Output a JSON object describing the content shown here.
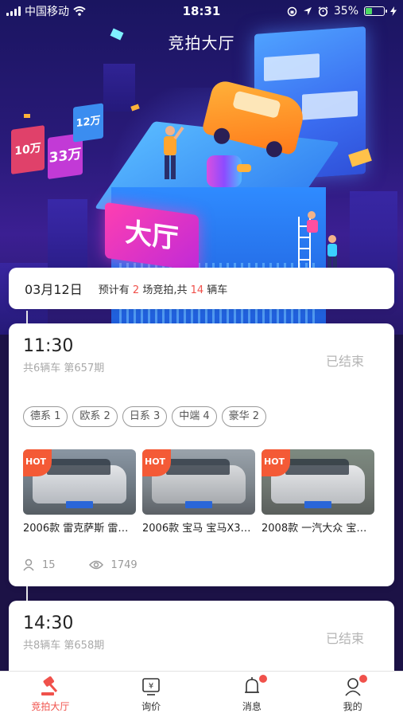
{
  "statusbar": {
    "carrier": "中国移动",
    "time": "18:31",
    "battery": "35%",
    "battery_level": 0.35
  },
  "page_title": "竞拍大厅",
  "hero": {
    "sign_text": "大厅",
    "price_tags": [
      "10万",
      "33万",
      "12万"
    ]
  },
  "date_card": {
    "date": "03月12日",
    "summary_prefix": "预计有",
    "session_count": "2",
    "summary_mid": "场竞拍,共",
    "car_count": "14",
    "summary_suffix": "辆车"
  },
  "sessions": [
    {
      "time": "11:30",
      "subtitle": "共6辆车 第657期",
      "status": "已结束",
      "tags": [
        "德系 1",
        "欧系 2",
        "日系 3",
        "中端 4",
        "豪华 2"
      ],
      "cars": [
        {
          "name": "2006款 雷克萨斯 雷…",
          "badge": "HOT",
          "color": "#c9ccd2"
        },
        {
          "name": "2006款 宝马 宝马X3…",
          "badge": "HOT",
          "color": "#b6b9bd"
        },
        {
          "name": "2008款 一汽大众 宝…",
          "badge": "HOT",
          "color": "#cfd1d4"
        }
      ],
      "participants": "15",
      "views": "1749"
    },
    {
      "time": "14:30",
      "subtitle": "共8辆车 第658期",
      "status": "已结束"
    }
  ],
  "tabbar": {
    "items": [
      {
        "label": "竞拍大厅",
        "icon": "gavel-icon",
        "active": true
      },
      {
        "label": "询价",
        "icon": "price-tag-icon"
      },
      {
        "label": "消息",
        "icon": "bell-icon",
        "badge": true
      },
      {
        "label": "我的",
        "icon": "user-icon",
        "badge": true
      }
    ]
  },
  "colors": {
    "accent": "#f0514b",
    "hot_badge": "#f45a36",
    "hero_bg": "#2a1a7a"
  }
}
